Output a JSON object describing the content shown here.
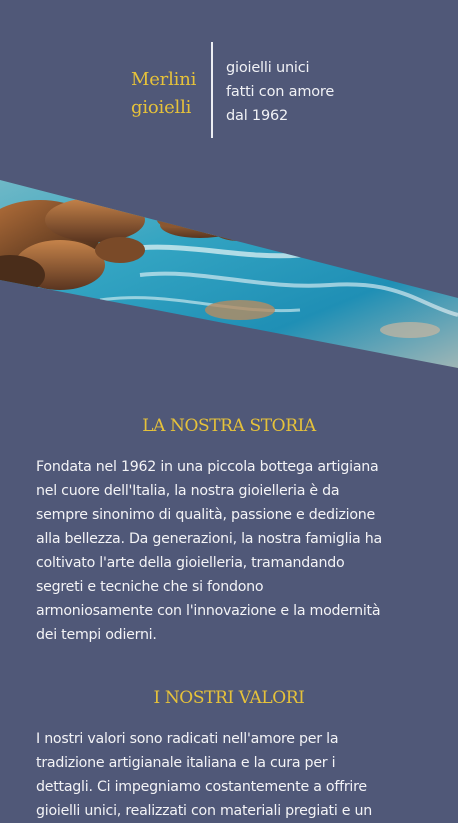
{
  "header": {
    "logo_line1": "Merlini",
    "logo_line2": "gioielli",
    "tagline": [
      "gioielli unici",
      "fatti con amore",
      "dal 1962"
    ]
  },
  "hero": {
    "icon": "seascape-rocks-image"
  },
  "sections": [
    {
      "title": "LA NOSTRA STORIA",
      "lines": [
        "Fondata nel 1962 in una piccola bottega artigiana",
        "nel cuore dell'Italia, la nostra gioielleria è da",
        "sempre sinonimo di qualità, passione e dedizione",
        "alla bellezza. Da generazioni, la nostra famiglia ha",
        "coltivato l'arte della gioielleria, tramandando",
        "segreti e tecniche che si fondono",
        "armoniosamente con l'innovazione e la modernità",
        "dei tempi odierni."
      ]
    },
    {
      "title": "I NOSTRI VALORI",
      "lines": [
        "I nostri valori sono radicati nell'amore per la",
        "tradizione artigianale italiana e la cura per i",
        "dettagli. Ci impegniamo costantemente a offrire",
        "gioielli unici, realizzati con materiali pregiati e un"
      ]
    }
  ],
  "colors": {
    "background": "#505878",
    "accent": "#e6c23a",
    "text": "#f3f3f6"
  }
}
